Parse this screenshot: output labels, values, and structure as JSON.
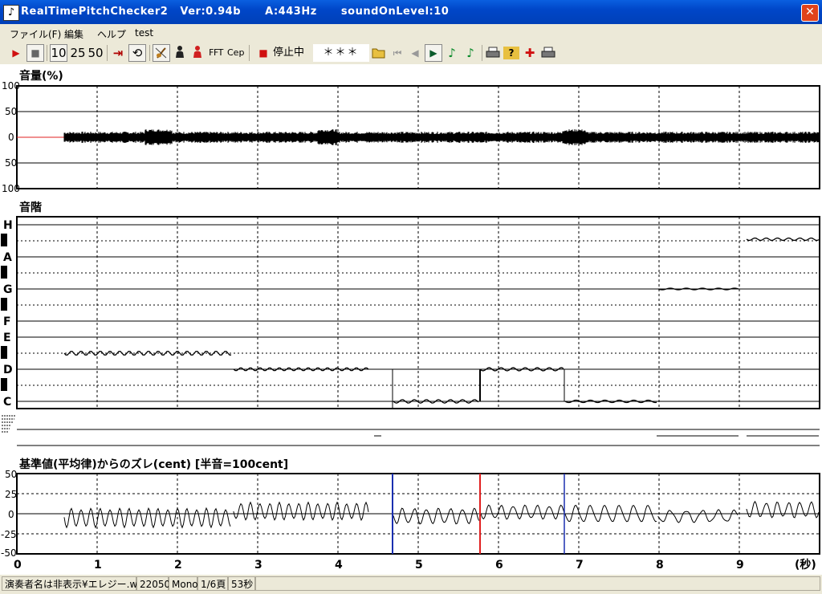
{
  "window": {
    "title": "RealTimePitchChecker2   Ver:0.94b      A:443Hz      soundOnLevel:10",
    "close_glyph": "✕",
    "app_icon_glyph": "♪"
  },
  "menu": [
    "ファイル(F)",
    "編集",
    "ヘルプ",
    "test"
  ],
  "toolbar": {
    "play_icon": "▶",
    "stop_icon": "■",
    "btn_10": "10",
    "btn_25": "25",
    "btn_50": "50",
    "jump_icon": "⇥",
    "loop_icon": "⟲",
    "fft_label": "FFT",
    "cep_label": "Cep",
    "status_text": "停止中",
    "display_text": "＊＊＊",
    "nav_icons": [
      "⏮",
      "◀",
      "▶"
    ],
    "note_icons": [
      "♪",
      "♪"
    ],
    "misc_icons": [
      "🖨",
      "?",
      "✚",
      "🖨"
    ]
  },
  "panels": {
    "volume": {
      "title": "音量(%)",
      "y_labels": [
        "100",
        "50",
        "0",
        "50",
        "100"
      ]
    },
    "scale": {
      "title": "音階",
      "note_labels": [
        "H",
        "A",
        "G",
        "F",
        "E",
        "D",
        "C"
      ]
    },
    "deviation": {
      "title": "基準値(平均律)からのズレ(cent) [半音=100cent]",
      "y_labels": [
        "50",
        "25",
        "0",
        "-25",
        "-50"
      ]
    }
  },
  "x_axis": {
    "ticks": [
      "0",
      "1",
      "2",
      "3",
      "4",
      "5",
      "6",
      "7",
      "8",
      "9"
    ],
    "unit": "(秒)"
  },
  "colors": {
    "accent_red": "#e02020",
    "marker_blue": "#1a2fb0",
    "grid": "#000000",
    "toolbar_red": "#d01010"
  },
  "status": {
    "file": "演奏者名は非表示¥エレジー.wav",
    "rate": "22050",
    "channels": "Mono",
    "page": "1/6頁",
    "duration": "53秒"
  }
}
